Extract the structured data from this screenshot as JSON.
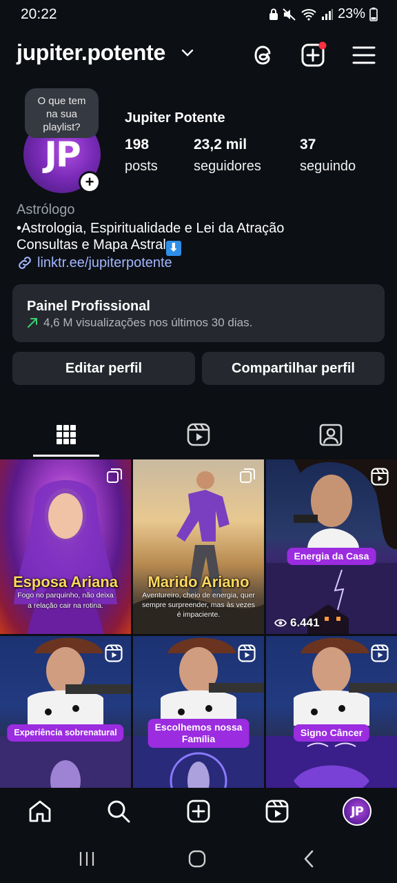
{
  "status_bar": {
    "time": "20:22",
    "battery": "23%"
  },
  "header": {
    "username": "jupiter.potente",
    "icons": [
      "chevron-down-icon",
      "threads-icon",
      "new-post-icon",
      "menu-icon"
    ]
  },
  "profile": {
    "avatar_initials": "JP",
    "note_bubble": {
      "line1": "O que tem",
      "line2": "na sua",
      "line3": "playlist?"
    },
    "name": "Jupiter Potente",
    "stats": [
      {
        "value": "198",
        "label": "posts"
      },
      {
        "value": "23,2 mil",
        "label": "seguidores"
      },
      {
        "value": "37",
        "label": "seguindo"
      }
    ],
    "category": "Astrólogo",
    "bio_line1": "•Astrologia, Espiritualidade e Lei da Atração",
    "bio_line2": "Consultas e Mapa Astral",
    "bio_emoji": "⬇",
    "link": "linktr.ee/jupiterpotente"
  },
  "dashboard": {
    "title": "Painel Profissional",
    "subtitle": "4,6 M visualizações nos últimos 30 dias."
  },
  "buttons": {
    "edit": "Editar perfil",
    "share": "Compartilhar perfil"
  },
  "tabs": [
    "grid-icon",
    "reels-icon",
    "tagged-icon"
  ],
  "posts": [
    {
      "type": "carousel",
      "title": "Esposa Ariana",
      "caption1": "Fogo no parquinho, não deixa",
      "caption2": "a relação cair na rotina."
    },
    {
      "type": "carousel",
      "title": "Marido Ariano",
      "caption1": "Aventureiro, cheio de energia, quer",
      "caption2": "sempre surpreender, mas às vezes",
      "caption3": "é impaciente."
    },
    {
      "type": "reel",
      "pill": "Energia da Casa",
      "views": "6.441"
    },
    {
      "type": "reel",
      "pill": "Experiência sobrenatural"
    },
    {
      "type": "reel",
      "pill_line1": "Escolhemos nossa",
      "pill_line2": "Família"
    },
    {
      "type": "reel",
      "pill": "Signo Câncer"
    }
  ],
  "bottom_nav": [
    "home-icon",
    "search-icon",
    "create-icon",
    "reels-icon",
    "profile-avatar"
  ],
  "colors": {
    "background": "#0c0f14",
    "card": "#25292f",
    "link": "#a2b6ff",
    "accent_purple": "#9b2ce0",
    "notification": "#ff3040"
  }
}
